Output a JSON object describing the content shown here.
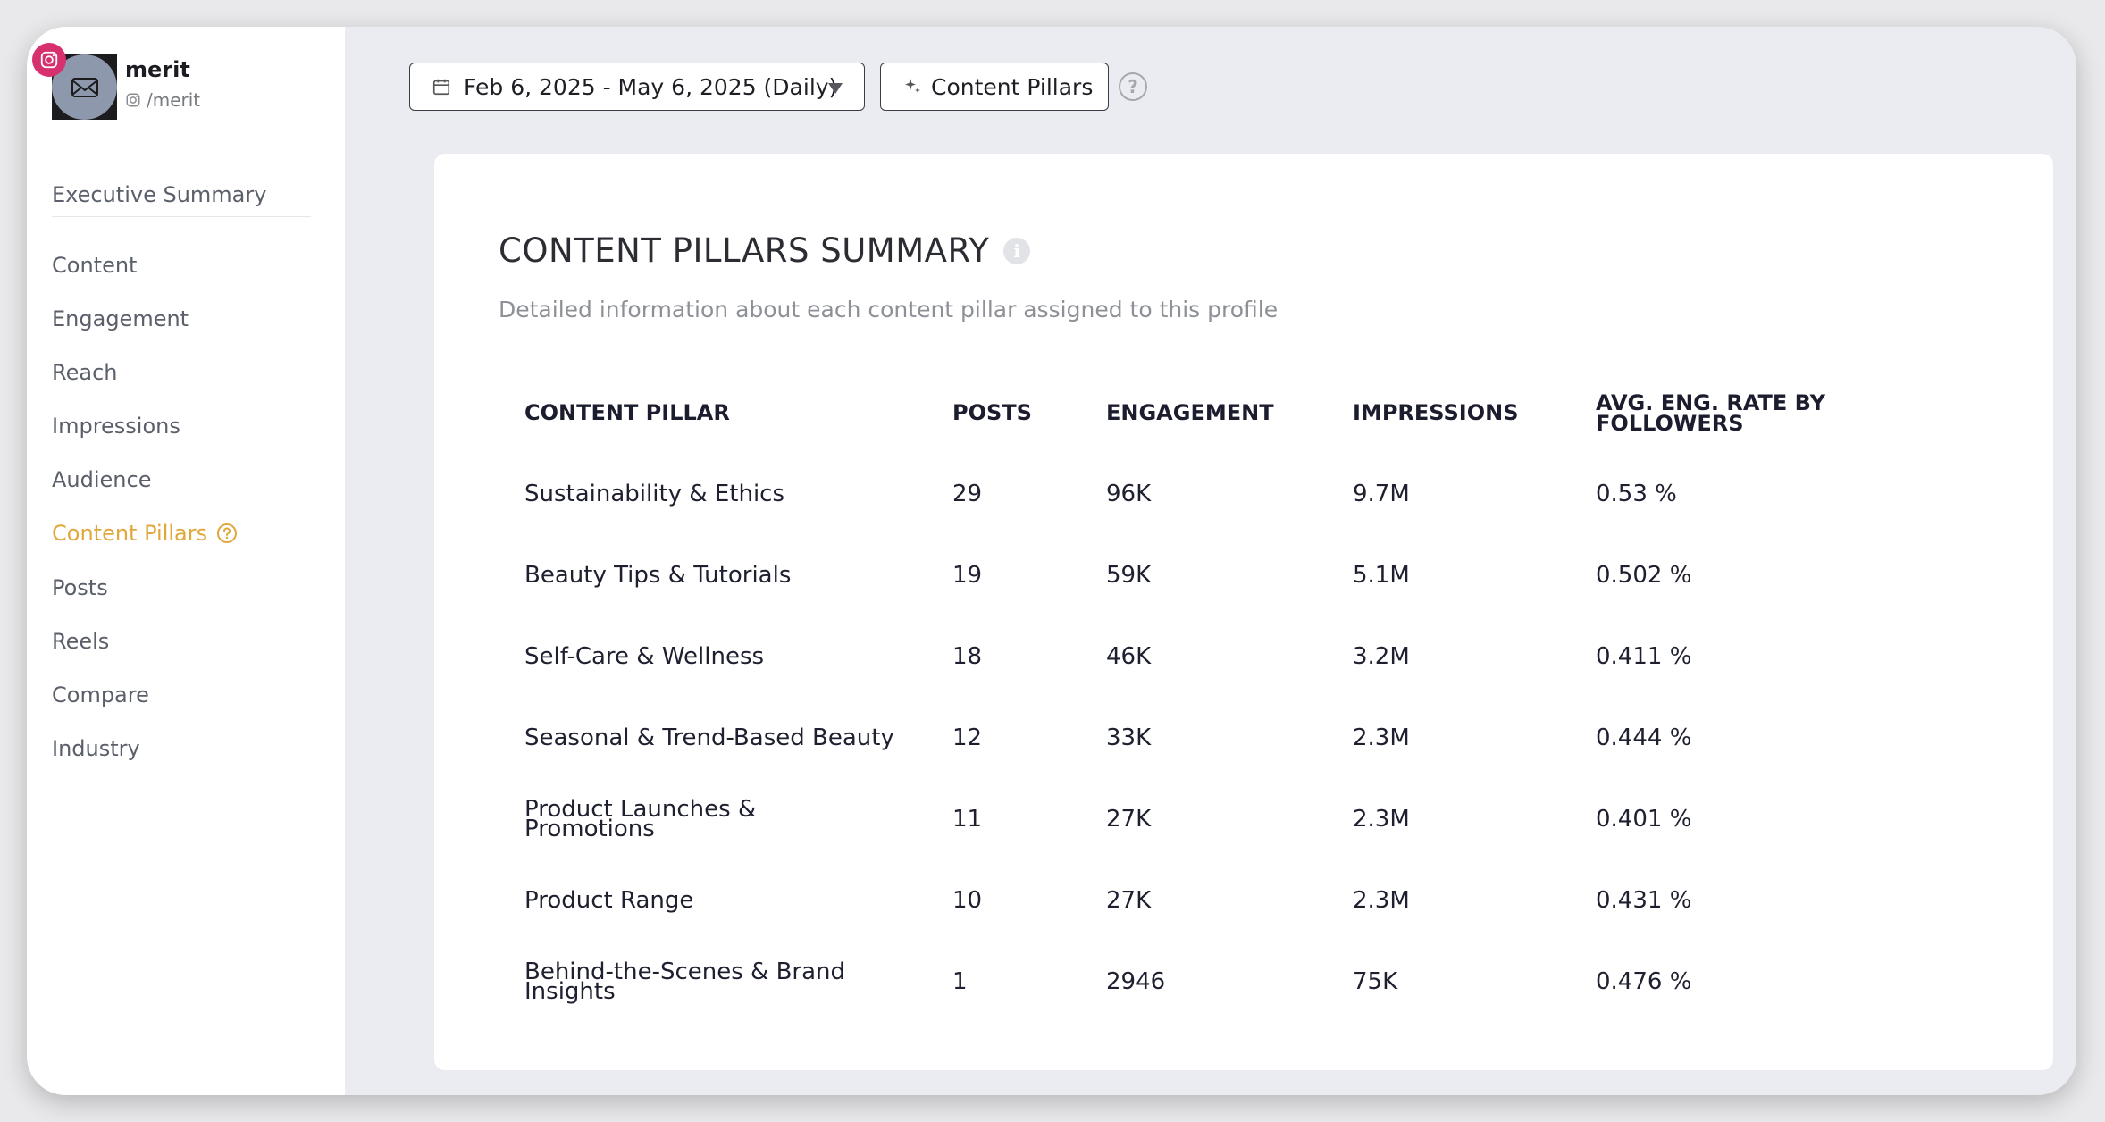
{
  "profile": {
    "name": "merit",
    "handle": "/merit"
  },
  "sidebar": {
    "items": [
      {
        "label": "Executive Summary"
      },
      {
        "label": "Content"
      },
      {
        "label": "Engagement"
      },
      {
        "label": "Reach"
      },
      {
        "label": "Impressions"
      },
      {
        "label": "Audience"
      },
      {
        "label": "Content Pillars"
      },
      {
        "label": "Posts"
      },
      {
        "label": "Reels"
      },
      {
        "label": "Compare"
      },
      {
        "label": "Industry"
      }
    ],
    "active": "Content Pillars"
  },
  "toolbar": {
    "date_range": "Feb 6, 2025 - May 6, 2025 (Daily)",
    "content_pillars_button": "Content Pillars"
  },
  "card": {
    "title": "CONTENT PILLARS SUMMARY",
    "subtitle": "Detailed information about each content pillar assigned to this profile"
  },
  "table": {
    "headers": [
      "CONTENT PILLAR",
      "POSTS",
      "ENGAGEMENT",
      "IMPRESSIONS",
      "AVG. ENG. RATE BY FOLLOWERS"
    ],
    "rows": [
      {
        "pillar": "Sustainability & Ethics",
        "posts": "29",
        "engagement": "96K",
        "impressions": "9.7M",
        "rate": "0.53 %"
      },
      {
        "pillar": "Beauty Tips & Tutorials",
        "posts": "19",
        "engagement": "59K",
        "impressions": "5.1M",
        "rate": "0.502 %"
      },
      {
        "pillar": "Self-Care & Wellness",
        "posts": "18",
        "engagement": "46K",
        "impressions": "3.2M",
        "rate": "0.411 %"
      },
      {
        "pillar": "Seasonal & Trend-Based Beauty",
        "posts": "12",
        "engagement": "33K",
        "impressions": "2.3M",
        "rate": "0.444 %"
      },
      {
        "pillar": "Product Launches & Promotions",
        "posts": "11",
        "engagement": "27K",
        "impressions": "2.3M",
        "rate": "0.401 %"
      },
      {
        "pillar": "Product Range",
        "posts": "10",
        "engagement": "27K",
        "impressions": "2.3M",
        "rate": "0.431 %"
      },
      {
        "pillar": "Behind-the-Scenes & Brand Insights",
        "posts": "1",
        "engagement": "2946",
        "impressions": "75K",
        "rate": "0.476 %"
      }
    ]
  },
  "colors": {
    "accent": "#e0a73a",
    "instagram": "#d6306f",
    "background": "#eaecf1"
  },
  "icons": [
    "instagram-icon",
    "calendar-icon",
    "dropdown-caret-icon",
    "sparkle-icon",
    "help-icon",
    "info-icon"
  ]
}
